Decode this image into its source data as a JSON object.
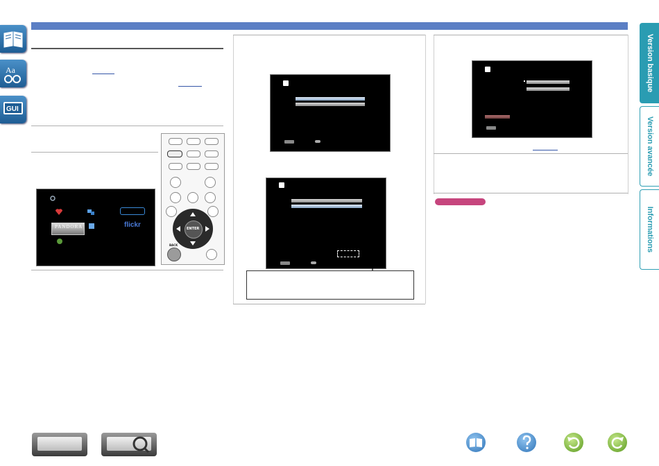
{
  "sidebar_tabs": [
    {
      "label": "Version basique"
    },
    {
      "label": "Version avancée"
    },
    {
      "label": "Informations"
    }
  ],
  "left_icons": [
    {
      "name": "book-icon"
    },
    {
      "name": "dictionary-icon"
    },
    {
      "name": "gui-icon"
    }
  ],
  "gui_label": "GUI",
  "remote": {
    "enter_label": "ENTER",
    "back_label": "BACK"
  },
  "screen": {
    "back_label": "BACK"
  },
  "services": {
    "pandora": "PANDORA",
    "flickr": "flickr"
  },
  "colors": {
    "top_bar": "#5b7fc4",
    "active_tab": "#2a9cb2",
    "note_badge": "#c6457d"
  }
}
